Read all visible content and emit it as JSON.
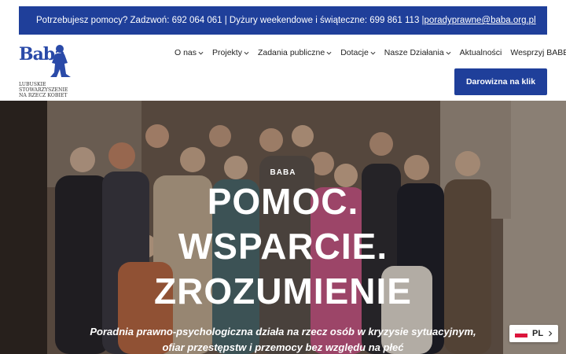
{
  "topbar": {
    "text": "Potrzebujesz pomocy? Zadzwoń: 692 064 061 | Dyżury weekendowe i świąteczne: 699 861 113 | ",
    "email": "poradyprawne@baba.org.pl"
  },
  "logo": {
    "word": "Baba",
    "subtitle_lines": [
      "LUBUSKIE",
      "STOWARZYSZENIE",
      "NA RZECZ KOBIET"
    ]
  },
  "nav": {
    "items": [
      {
        "label": "O nas",
        "has_dropdown": true
      },
      {
        "label": "Projekty",
        "has_dropdown": true
      },
      {
        "label": "Zadania publiczne",
        "has_dropdown": true
      },
      {
        "label": "Dotacje",
        "has_dropdown": true
      },
      {
        "label": "Nasze Działania",
        "has_dropdown": true
      },
      {
        "label": "Aktualności",
        "has_dropdown": false
      },
      {
        "label": "Wesprzyj BABĘ",
        "has_dropdown": true
      }
    ]
  },
  "donate_button": {
    "label": "Darowizna na klik"
  },
  "hero": {
    "kicker": "BABA",
    "title_lines": [
      "POMOC.",
      "WSPARCIE.",
      "ZROZUMIENIE"
    ],
    "subtitle_lines": [
      "Poradnia prawno-psychologiczna działa na rzecz osób w kryzysie sytuacyjnym,",
      "ofiar przestępstw i przemocy bez względu na płeć"
    ]
  },
  "language": {
    "code": "PL",
    "flag": "poland-flag-icon"
  },
  "colors": {
    "brand_blue": "#1f3f9a",
    "white": "#ffffff"
  }
}
